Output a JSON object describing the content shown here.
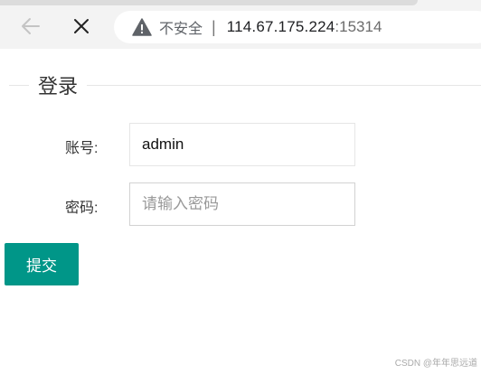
{
  "browser": {
    "security_label": "不安全",
    "separator": "|",
    "url_host": "114.67.175.224",
    "url_port": ":15314",
    "icons": {
      "back": "arrow-left-icon",
      "close": "close-icon",
      "warning": "warning-triangle-icon"
    }
  },
  "form": {
    "legend": "登录",
    "account_label": "账号:",
    "account_value": "admin",
    "password_label": "密码:",
    "password_placeholder": "请输入密码",
    "submit_label": "提交",
    "accent_color": "#009688"
  },
  "watermark": "CSDN @年年思远道"
}
